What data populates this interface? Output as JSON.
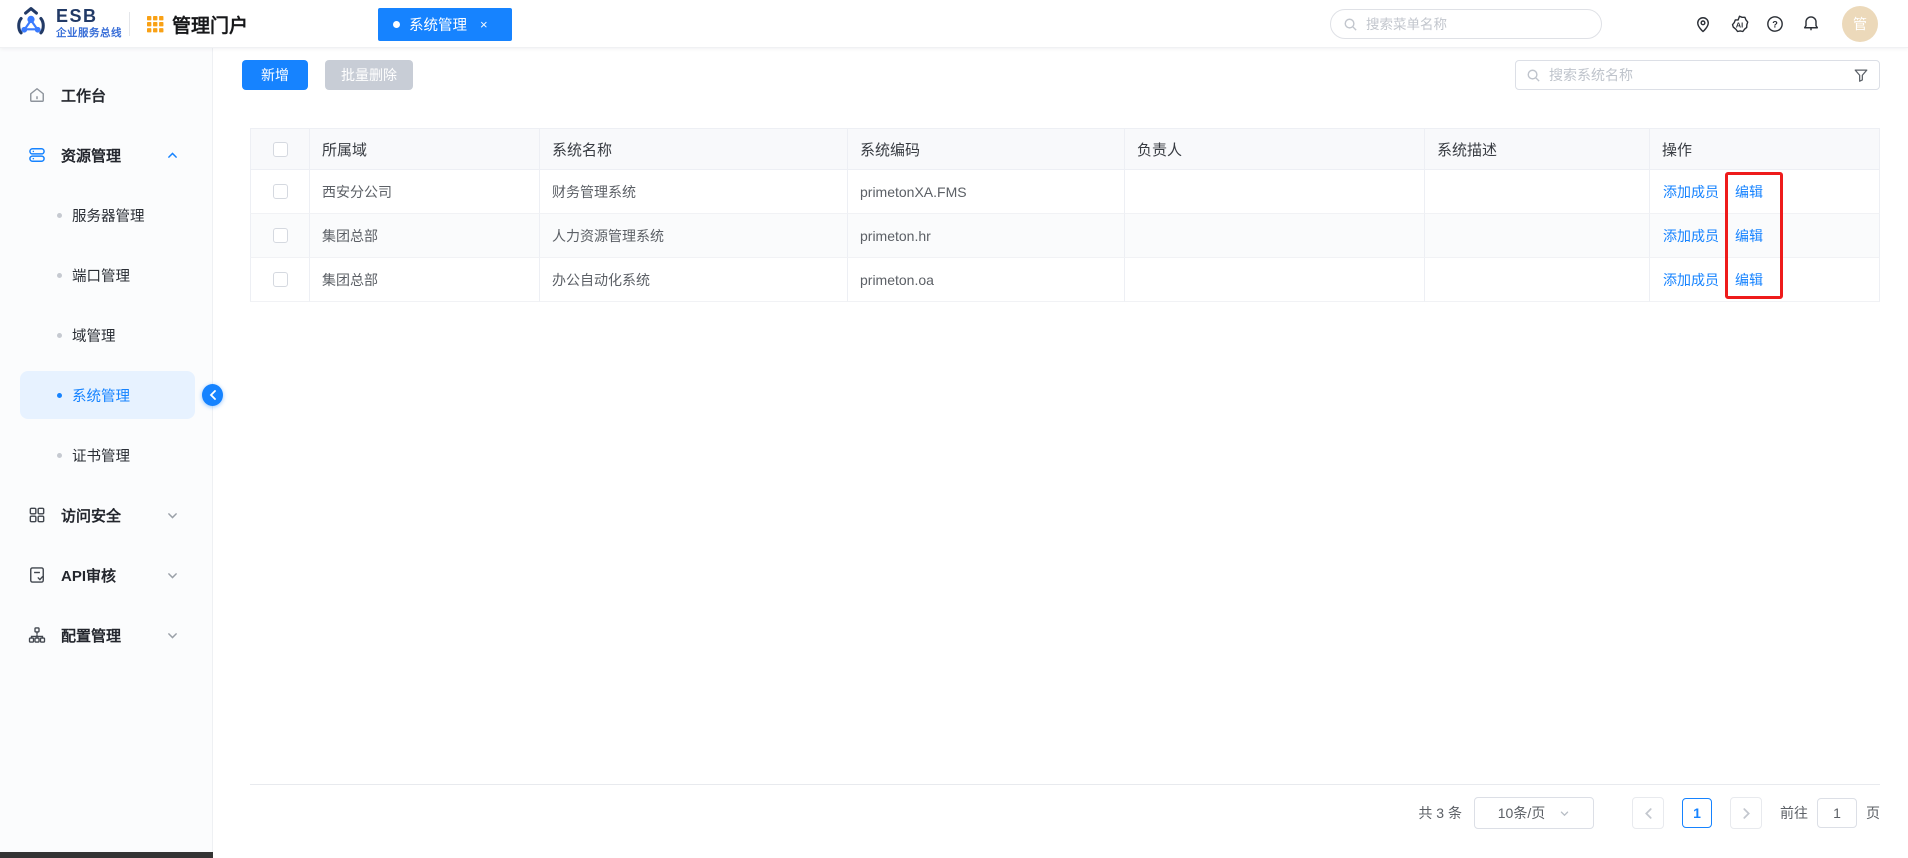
{
  "colors": {
    "primary": "#1683ff",
    "annotation_red": "#ee1b1b",
    "avatar_bg": "#ecd9ba",
    "grid_icon_orange": "#f9a115",
    "disabled_button": "#c8cdd6",
    "active_item_bg": "#e7f2ff"
  },
  "header": {
    "logo_title": "ESB",
    "logo_subtitle": "企业服务总线",
    "portal_title": "管理门户",
    "tab": {
      "label": "系统管理",
      "close_label": "×"
    },
    "menu_search_placeholder": "搜索菜单名称",
    "avatar_label": "管"
  },
  "sidebar": {
    "items": [
      {
        "label": "工作台",
        "type": "top",
        "icon": "home-icon"
      },
      {
        "label": "资源管理",
        "type": "top",
        "icon": "server-icon",
        "expanded": true
      },
      {
        "label": "服务器管理",
        "type": "sub"
      },
      {
        "label": "端口管理",
        "type": "sub"
      },
      {
        "label": "域管理",
        "type": "sub"
      },
      {
        "label": "系统管理",
        "type": "sub",
        "active": true
      },
      {
        "label": "证书管理",
        "type": "sub"
      },
      {
        "label": "访问安全",
        "type": "top",
        "icon": "grid-icon",
        "collapsed": true
      },
      {
        "label": "API审核",
        "type": "top",
        "icon": "doc-icon",
        "collapsed": true
      },
      {
        "label": "配置管理",
        "type": "top",
        "icon": "sitemap-icon",
        "collapsed": true
      }
    ]
  },
  "toolbar": {
    "add_label": "新增",
    "batch_delete_label": "批量删除",
    "system_search_placeholder": "搜索系统名称"
  },
  "table": {
    "columns": [
      "所属域",
      "系统名称",
      "系统编码",
      "负责人",
      "系统描述",
      "操作"
    ],
    "rows": [
      {
        "domain": "西安分公司",
        "name": "财务管理系统",
        "code": "primetonXA.FMS",
        "owner": "",
        "desc": ""
      },
      {
        "domain": "集团总部",
        "name": "人力资源管理系统",
        "code": "primeton.hr",
        "owner": "",
        "desc": ""
      },
      {
        "domain": "集团总部",
        "name": "办公自动化系统",
        "code": "primeton.oa",
        "owner": "",
        "desc": ""
      }
    ],
    "action_add_member": "添加成员",
    "action_edit": "编辑"
  },
  "pagination": {
    "total_label": "共 3 条",
    "page_size_label": "10条/页",
    "current_page": "1",
    "goto_label": "前往",
    "goto_value": "1",
    "unit_label": "页"
  }
}
